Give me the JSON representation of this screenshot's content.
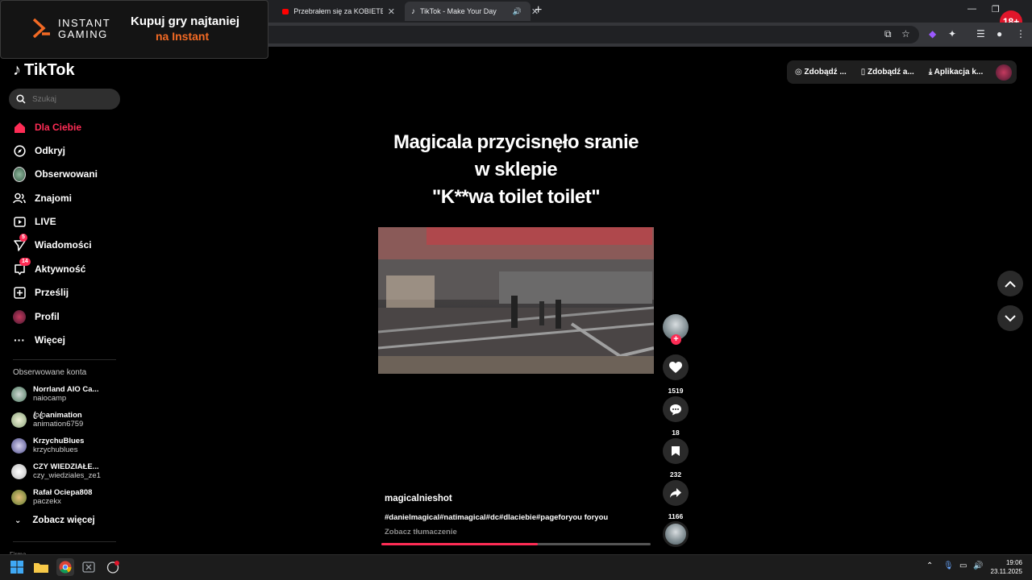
{
  "browser": {
    "tabs": [
      {
        "title": "Przebrałem się za KOBIETĘ na S",
        "icon": "youtube-icon"
      },
      {
        "title": "TikTok - Make Your Day",
        "icon": "tiktok-icon",
        "active": true
      }
    ],
    "badge": "18+"
  },
  "ad": {
    "brand_line1": "INSTANT",
    "brand_line2": "GAMING",
    "headline": "Kupuj gry najtaniej",
    "subline": "na Instant",
    "accent_color": "#f36a24"
  },
  "tiktok": {
    "logo": "TikTok",
    "search_placeholder": "Szukaj",
    "nav": [
      {
        "label": "Dla Ciebie",
        "icon": "home-icon"
      },
      {
        "label": "Odkryj",
        "icon": "compass-icon"
      },
      {
        "label": "Obserwowani",
        "icon": "following-avatar-icon"
      },
      {
        "label": "Znajomi",
        "icon": "friends-icon"
      },
      {
        "label": "LIVE",
        "icon": "live-icon"
      },
      {
        "label": "Wiadomości",
        "icon": "messages-icon",
        "badge": "5"
      },
      {
        "label": "Aktywność",
        "icon": "activity-icon",
        "badge": "14"
      },
      {
        "label": "Prześlij",
        "icon": "upload-icon"
      },
      {
        "label": "Profil",
        "icon": "profile-avatar-icon"
      },
      {
        "label": "Więcej",
        "icon": "more-icon"
      }
    ],
    "following_title": "Obserwowane konta",
    "accounts": [
      {
        "name": "Norrland AIO Ca...",
        "handle": "naiocamp",
        "color": "#5d8a6e"
      },
      {
        "name": "ꦿꦿanimation",
        "handle": "animation6759",
        "color": "#8aa37a"
      },
      {
        "name": "KrzychuBlues",
        "handle": "krzychublues",
        "color": "#6a6aa0"
      },
      {
        "name": "CZY WIEDZIAŁE...",
        "handle": "czy_wiedziales_ze1",
        "color": "#dddddd"
      },
      {
        "name": "Rafał Ociepa808",
        "handle": "paczekx",
        "color": "#7a9a4a"
      }
    ],
    "see_more": "Zobacz więcej",
    "footer_hint": "Firma",
    "top_actions": [
      "Zdobądź ...",
      "Zdobądź a...",
      "Aplikacja k..."
    ],
    "brand_color": "#fe2c55"
  },
  "video": {
    "caption_lines": [
      "Magicala przycisnęło sranie",
      "w sklepie",
      "\"K**wa toilet toilet\""
    ],
    "author": "magicalnieshot",
    "hashtags": "#danielmagical#natimagical#dc#dlaciebie#pageforyou foryou",
    "translate": "Zobacz tłumaczenie",
    "progress": 0.58,
    "likes": "1519",
    "comments": "18",
    "saves": "232",
    "shares": "1166"
  },
  "taskbar": {
    "time": "19:06",
    "date": "23.11.2025"
  }
}
